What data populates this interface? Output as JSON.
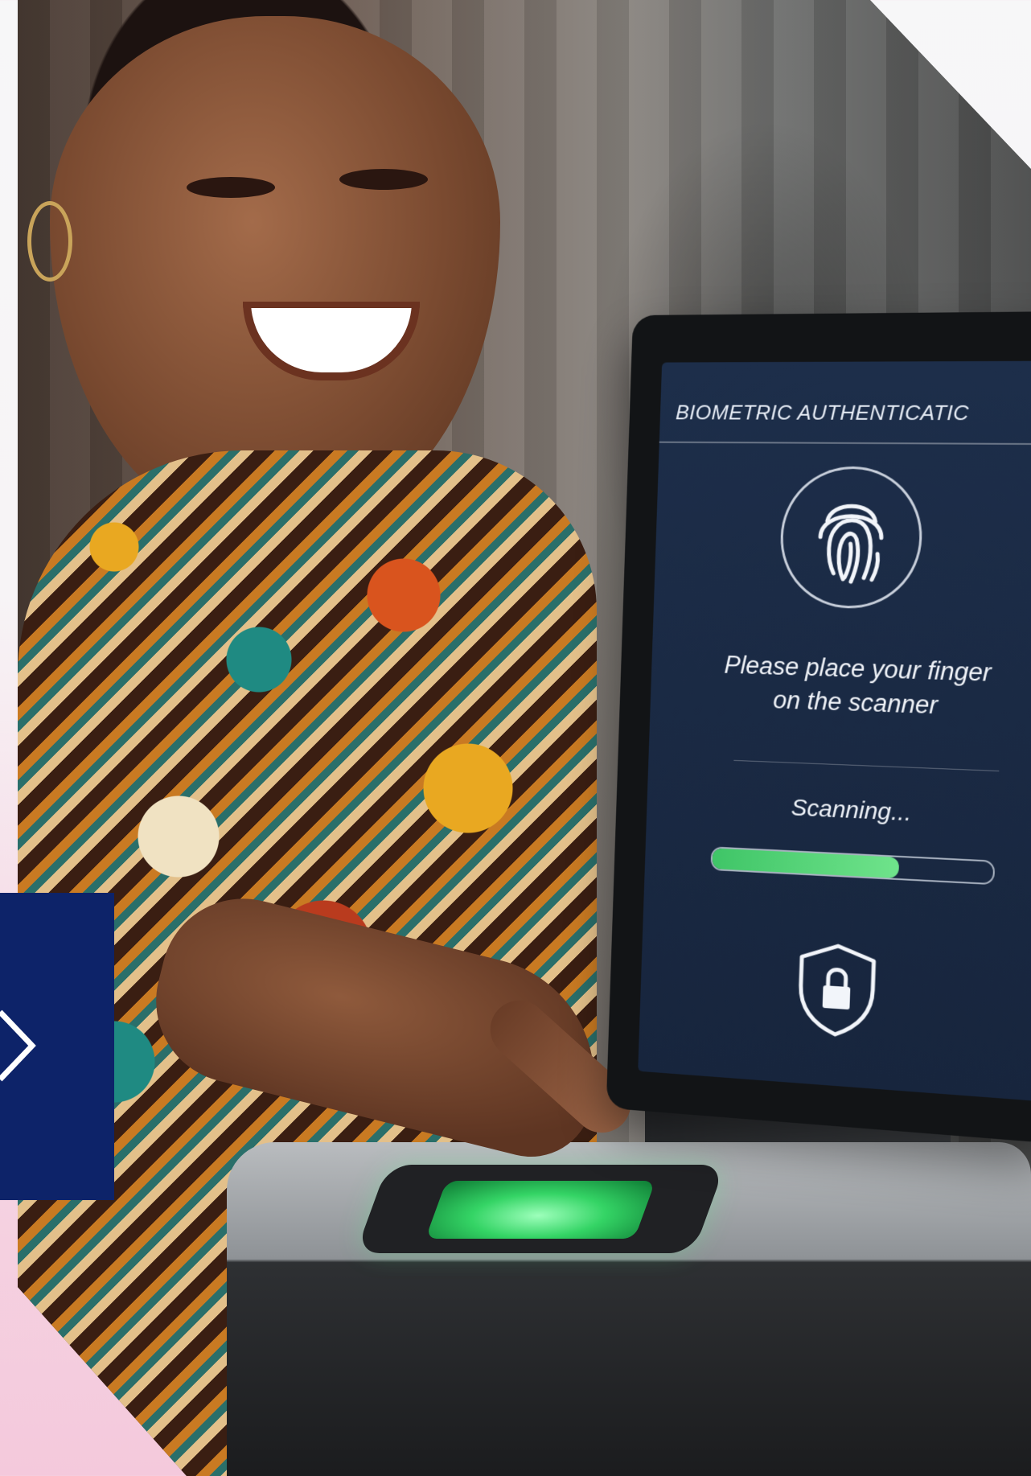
{
  "screen": {
    "title": "BIOMETRIC AUTHENTICATIC",
    "prompt_line1": "Please place your finger",
    "prompt_line2": "on the scanner",
    "status": "Scanning...",
    "progress": 0.67
  },
  "icons": {
    "fingerprint": "fingerprint-icon",
    "lock": "shield-lock-icon",
    "chevron": "chevron-right-icon"
  },
  "colors": {
    "badge": "#0d2369",
    "progress": "#4fd274",
    "screen": "#1d2e4a"
  }
}
